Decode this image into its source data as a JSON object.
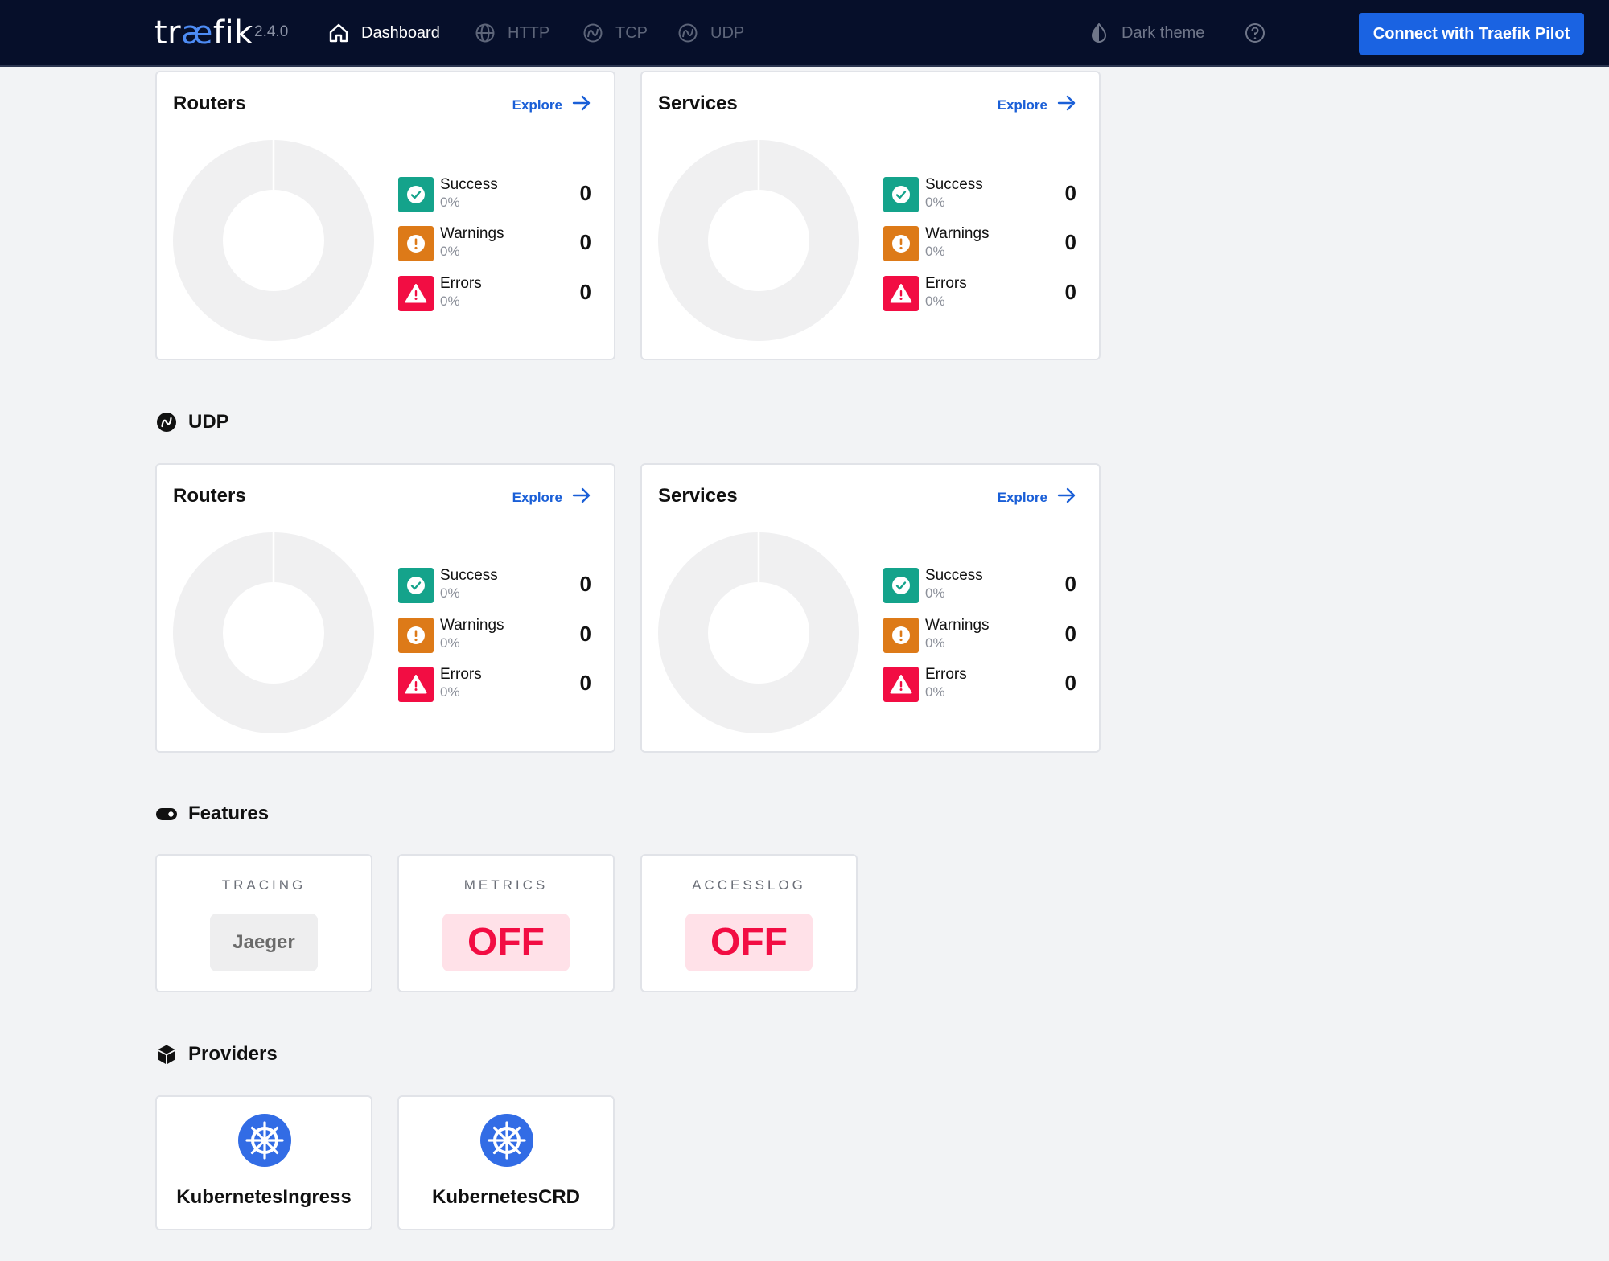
{
  "header": {
    "logo_text": {
      "pre": "tr",
      "ae": "æ",
      "post": "fik"
    },
    "version": "2.4.0",
    "nav": {
      "dashboard": "Dashboard",
      "http": "HTTP",
      "tcp": "TCP",
      "udp": "UDP"
    },
    "theme_label": "Dark theme",
    "pilot_button": "Connect with Traefik Pilot"
  },
  "tcp": {
    "routers": {
      "title": "Routers",
      "explore": "Explore",
      "stats": {
        "success": {
          "label": "Success",
          "percent": "0%",
          "count": "0"
        },
        "warnings": {
          "label": "Warnings",
          "percent": "0%",
          "count": "0"
        },
        "errors": {
          "label": "Errors",
          "percent": "0%",
          "count": "0"
        }
      }
    },
    "services": {
      "title": "Services",
      "explore": "Explore",
      "stats": {
        "success": {
          "label": "Success",
          "percent": "0%",
          "count": "0"
        },
        "warnings": {
          "label": "Warnings",
          "percent": "0%",
          "count": "0"
        },
        "errors": {
          "label": "Errors",
          "percent": "0%",
          "count": "0"
        }
      }
    }
  },
  "udp": {
    "section_title": "UDP",
    "routers": {
      "title": "Routers",
      "explore": "Explore",
      "stats": {
        "success": {
          "label": "Success",
          "percent": "0%",
          "count": "0"
        },
        "warnings": {
          "label": "Warnings",
          "percent": "0%",
          "count": "0"
        },
        "errors": {
          "label": "Errors",
          "percent": "0%",
          "count": "0"
        }
      }
    },
    "services": {
      "title": "Services",
      "explore": "Explore",
      "stats": {
        "success": {
          "label": "Success",
          "percent": "0%",
          "count": "0"
        },
        "warnings": {
          "label": "Warnings",
          "percent": "0%",
          "count": "0"
        },
        "errors": {
          "label": "Errors",
          "percent": "0%",
          "count": "0"
        }
      }
    }
  },
  "features": {
    "section_title": "Features",
    "tracing": {
      "label": "TRACING",
      "value": "Jaeger"
    },
    "metrics": {
      "label": "METRICS",
      "value": "OFF"
    },
    "accesslog": {
      "label": "ACCESSLOG",
      "value": "OFF"
    }
  },
  "providers": {
    "section_title": "Providers",
    "items": [
      "KubernetesIngress",
      "KubernetesCRD"
    ]
  },
  "colors": {
    "topbar": "#060f2a",
    "accent": "#1a63e2",
    "success": "#14a38b",
    "warning": "#dd7a18",
    "error": "#f20d43"
  },
  "icons": {
    "nav_dashboard": "home-icon",
    "nav_http": "globe-icon",
    "nav_tcp": "tcp-icon",
    "nav_udp": "udp-icon",
    "theme": "contrast-icon",
    "help": "help-circle-icon",
    "explore": "arrow-right-icon",
    "success": "check-circle-icon",
    "warning": "exclamation-circle-icon",
    "error": "warning-triangle-icon",
    "features": "toggle-icon",
    "providers": "cube-icon",
    "provider": "kubernetes-icon"
  }
}
